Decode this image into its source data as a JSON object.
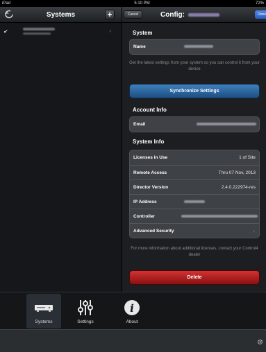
{
  "status_bar": {
    "device": "iPad",
    "time": "5:10 PM",
    "battery": "72%"
  },
  "left": {
    "title": "Systems",
    "add_label": "+",
    "systems": [
      {
        "checked": true
      }
    ]
  },
  "right": {
    "cancel_label": "Cancel",
    "title": "Config:",
    "done_label": "Done",
    "system_section": {
      "header": "System",
      "name_label": "Name"
    },
    "sync_note": "Get the latest settings from your system so you can control it from your device",
    "sync_button": "Synchronize Settings",
    "account_section": {
      "header": "Account Info",
      "email_label": "Email"
    },
    "system_info": {
      "header": "System Info",
      "rows": [
        {
          "label": "Licenses in Use",
          "value": "1 of Site"
        },
        {
          "label": "Remote Access",
          "value": "Thru 07 Nov, 2013"
        },
        {
          "label": "Director Version",
          "value": "2.4.0.222974-res"
        },
        {
          "label": "IP Address",
          "value": ""
        },
        {
          "label": "Controller",
          "value": ""
        },
        {
          "label": "Advanced Security",
          "value": ""
        }
      ]
    },
    "license_note": "For more information about additional licenses, contact your Control4 dealer",
    "delete_button": "Delete"
  },
  "tabbar": {
    "tabs": [
      {
        "label": "Systems",
        "icon": "systems-icon",
        "active": true
      },
      {
        "label": "Settings",
        "icon": "settings-icon",
        "active": false
      },
      {
        "label": "About",
        "icon": "about-icon",
        "active": false
      }
    ]
  },
  "colors": {
    "sync_blue": "#2f6aa6",
    "delete_red": "#b01d1d",
    "done_blue": "#3b74d8"
  }
}
